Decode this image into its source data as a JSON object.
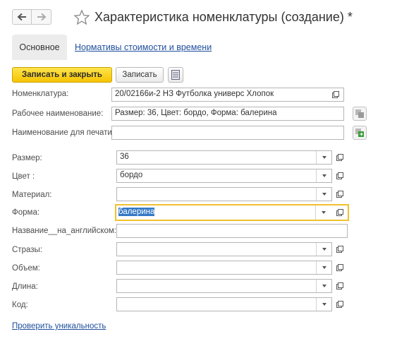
{
  "window": {
    "title": "Характеристика номенклатуры (создание) *"
  },
  "tabs": [
    {
      "label": "Основное"
    },
    {
      "label": "Нормативы стоимости и времени"
    }
  ],
  "toolbar": {
    "save_close": "Записать и закрыть",
    "save": "Записать"
  },
  "top_fields": [
    {
      "label": "Номенклатура:",
      "value": "20/02166и-2 НЗ Футболка универс Хлопок"
    },
    {
      "label": "Рабочее наименование:",
      "value": "Размер: 36, Цвет: бордо, Форма: балерина"
    },
    {
      "label": "Наименование для печати:",
      "value": ""
    }
  ],
  "attributes": [
    {
      "label": "Размер:",
      "value": "36"
    },
    {
      "label": "Цвет :",
      "value": "бордо"
    },
    {
      "label": "Материал:",
      "value": ""
    },
    {
      "label": "Форма:",
      "value": "балерина"
    },
    {
      "label": "Название__на_английском:",
      "value": ""
    },
    {
      "label": "Стразы:",
      "value": ""
    },
    {
      "label": "Объем:",
      "value": ""
    },
    {
      "label": "Длина:",
      "value": ""
    },
    {
      "label": "Код:",
      "value": ""
    }
  ],
  "footer": {
    "check_link": "Проверить уникальность"
  }
}
